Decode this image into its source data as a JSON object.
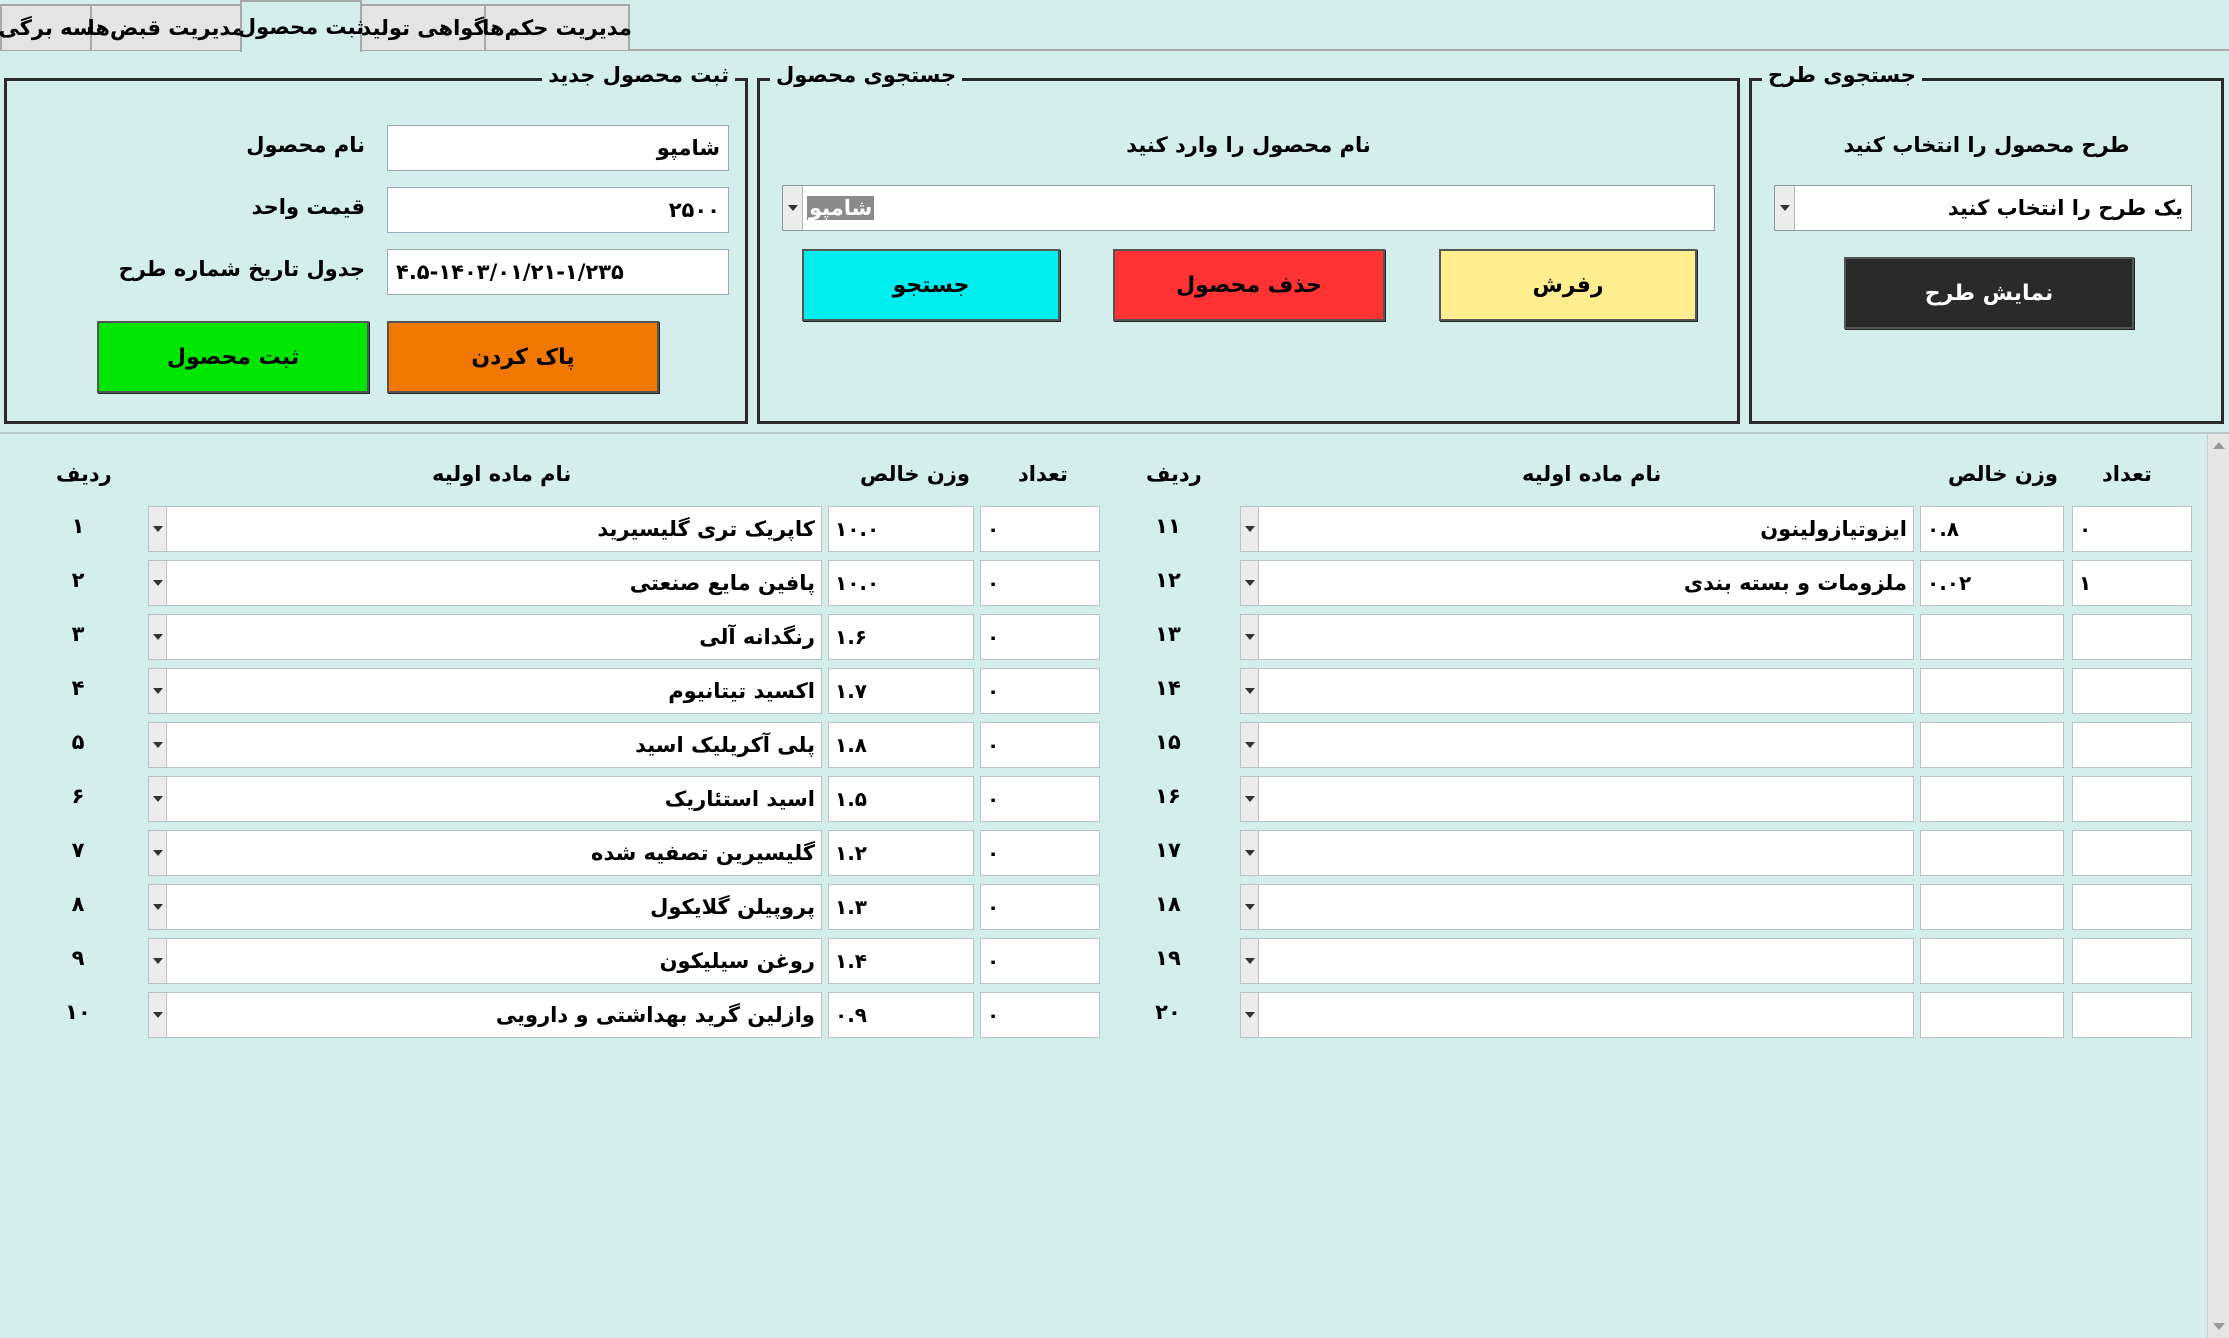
{
  "tabs": [
    {
      "label": "سه برگی"
    },
    {
      "label": "مدیریت قبض‌ها"
    },
    {
      "label": "ثبت محصول",
      "active": true
    },
    {
      "label": "گواهی تولید"
    },
    {
      "label": "مدیریت حکم‌ها"
    }
  ],
  "register": {
    "title": "ثبت محصول جدید",
    "name_label": "نام محصول",
    "name_value": "شامپو",
    "price_label": "قیمت واحد",
    "price_value": "۲۵۰۰",
    "table_label": "جدول  تاریخ  شماره طرح",
    "table_value": "۴.۵-۱۴۰۳/۰۱/۲۱-۱/۲۳۵",
    "submit_label": "ثبت محصول",
    "clear_label": "پاک کردن"
  },
  "search_product": {
    "title": "جستجوی محصول",
    "prompt": "نام محصول را وارد کنید",
    "combo_value": "شامپو",
    "search_label": "جستجو",
    "delete_label": "حذف محصول",
    "refresh_label": "رفرش"
  },
  "search_plan": {
    "title": "جستجوی طرح",
    "prompt": "طرح محصول را انتخاب کنید",
    "combo_value": "یک طرح را انتخاب کنید",
    "show_label": "نمایش طرح"
  },
  "grid": {
    "headers": {
      "row": "ردیف",
      "material": "نام ماده اولیه",
      "weight": "وزن خالص",
      "count": "تعداد"
    },
    "left_rows": [
      {
        "num": "۱",
        "material": "کاپریک تری گلیسیرید",
        "weight": "۱۰.۰",
        "count": "۰"
      },
      {
        "num": "۲",
        "material": "پافین مایع صنعتی",
        "weight": "۱۰.۰",
        "count": "۰"
      },
      {
        "num": "۳",
        "material": "رنگدانه آلی",
        "weight": "۱.۶",
        "count": "۰"
      },
      {
        "num": "۴",
        "material": "اکسید تیتانیوم",
        "weight": "۱.۷",
        "count": "۰"
      },
      {
        "num": "۵",
        "material": "پلی آکریلیک اسید",
        "weight": "۱.۸",
        "count": "۰"
      },
      {
        "num": "۶",
        "material": "اسید استئاریک",
        "weight": "۱.۵",
        "count": "۰"
      },
      {
        "num": "۷",
        "material": "گلیسیرین تصفیه شده",
        "weight": "۱.۲",
        "count": "۰"
      },
      {
        "num": "۸",
        "material": "پروپیلن گلایکول",
        "weight": "۱.۳",
        "count": "۰"
      },
      {
        "num": "۹",
        "material": "روغن سیلیکون",
        "weight": "۱.۴",
        "count": "۰"
      },
      {
        "num": "۱۰",
        "material": "وازلین گرید بهداشتی و دارویی",
        "weight": "۰.۹",
        "count": "۰"
      }
    ],
    "right_rows": [
      {
        "num": "۱۱",
        "material": "ایزوتیازولینون",
        "weight": "۰.۸",
        "count": "۰"
      },
      {
        "num": "۱۲",
        "material": "ملزومات و بسته بندی",
        "weight": "۰.۰۲",
        "count": "۱"
      },
      {
        "num": "۱۳",
        "material": "",
        "weight": "",
        "count": ""
      },
      {
        "num": "۱۴",
        "material": "",
        "weight": "",
        "count": ""
      },
      {
        "num": "۱۵",
        "material": "",
        "weight": "",
        "count": ""
      },
      {
        "num": "۱۶",
        "material": "",
        "weight": "",
        "count": ""
      },
      {
        "num": "۱۷",
        "material": "",
        "weight": "",
        "count": ""
      },
      {
        "num": "۱۸",
        "material": "",
        "weight": "",
        "count": ""
      },
      {
        "num": "۱۹",
        "material": "",
        "weight": "",
        "count": ""
      },
      {
        "num": "۲۰",
        "material": "",
        "weight": "",
        "count": ""
      }
    ]
  },
  "colors": {
    "background": "#d4eeec",
    "submit": "#00e600",
    "clear": "#f07800",
    "search": "#00eeee",
    "delete": "#ff3333",
    "refresh": "#ffee90",
    "show": "#2a2a2a"
  }
}
